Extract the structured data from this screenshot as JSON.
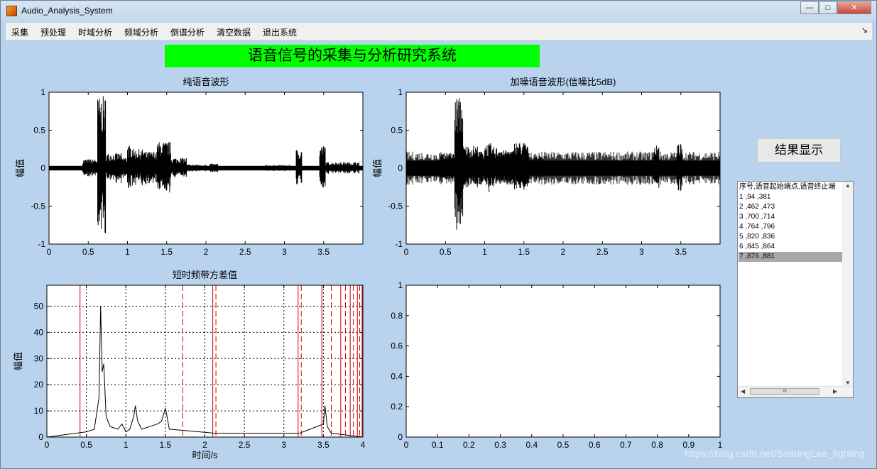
{
  "window": {
    "title": "Audio_Analysis_System",
    "buttons": {
      "minimize": "—",
      "maximize": "□",
      "close": "✕"
    }
  },
  "menu": {
    "items": [
      "采集",
      "预处理",
      "时域分析",
      "频域分析",
      "倒谱分析",
      "清空数据",
      "退出系统"
    ],
    "more": "↘"
  },
  "banner": {
    "title": "语音信号的采集与分析研究系统",
    "color": "#00ff00"
  },
  "result_button": {
    "label": "结果显示"
  },
  "results_list": {
    "header": "序号,语音起始端点,语音终止端",
    "rows": [
      "1 ,94 ,381",
      "2 ,462 ,473",
      "3 ,700 ,714",
      "4 ,764 ,796",
      "5 ,820 ,836",
      "6 ,845 ,864",
      "7 ,876 ,881"
    ],
    "selected_index": 6,
    "h_thumb_glyph": "III"
  },
  "chart_data": [
    {
      "id": "clean",
      "type": "line",
      "title": "纯语音波形",
      "xlabel": "",
      "ylabel": "幅值",
      "xlim": [
        0,
        4
      ],
      "ylim": [
        -1,
        1
      ],
      "xticks": [
        "0",
        "0.5",
        "1",
        "1.5",
        "2",
        "2.5",
        "3",
        "3.5"
      ],
      "yticks": [
        "-1",
        "-0.5",
        "0",
        "0.5",
        "1"
      ],
      "segments": [
        [
          0.43,
          0.62,
          0.12
        ],
        [
          0.62,
          0.72,
          0.95
        ],
        [
          0.72,
          0.92,
          0.2
        ],
        [
          0.92,
          1.0,
          0.15
        ],
        [
          1.0,
          1.08,
          0.3
        ],
        [
          1.08,
          1.22,
          0.25
        ],
        [
          1.22,
          1.38,
          0.22
        ],
        [
          1.38,
          1.55,
          0.35
        ],
        [
          1.55,
          1.75,
          0.14
        ],
        [
          1.75,
          2.0,
          0.05
        ],
        [
          2.05,
          2.15,
          0.06
        ],
        [
          2.75,
          3.1,
          0.04
        ],
        [
          3.15,
          3.22,
          0.25
        ],
        [
          3.45,
          3.52,
          0.3
        ],
        [
          3.52,
          3.95,
          0.08
        ]
      ],
      "color": "#000000"
    },
    {
      "id": "noisy",
      "type": "line",
      "title": "加噪语音波形(信噪比5dB)",
      "xlabel": "",
      "ylabel": "幅值",
      "xlim": [
        0,
        4
      ],
      "ylim": [
        -1,
        1
      ],
      "xticks": [
        "0",
        "0.5",
        "1",
        "1.5",
        "2",
        "2.5",
        "3",
        "3.5"
      ],
      "yticks": [
        "-1",
        "-0.5",
        "0",
        "0.5",
        "1"
      ],
      "noise": 0.1,
      "segments": [
        [
          0.43,
          0.62,
          0.2
        ],
        [
          0.62,
          0.72,
          0.95
        ],
        [
          0.72,
          0.92,
          0.3
        ],
        [
          0.92,
          1.0,
          0.22
        ],
        [
          1.0,
          1.08,
          0.33
        ],
        [
          1.08,
          1.22,
          0.28
        ],
        [
          1.22,
          1.38,
          0.24
        ],
        [
          1.38,
          1.55,
          0.35
        ],
        [
          1.55,
          1.75,
          0.15
        ],
        [
          3.15,
          3.22,
          0.3
        ],
        [
          3.45,
          3.52,
          0.32
        ]
      ],
      "color": "#000000"
    },
    {
      "id": "variance",
      "type": "line",
      "title": "短时频带方差值",
      "xlabel": "时间/s",
      "ylabel": "幅值",
      "xlim": [
        0,
        4
      ],
      "ylim": [
        0,
        58
      ],
      "grid": true,
      "xticks": [
        "0",
        "0.5",
        "1",
        "1.5",
        "2",
        "2.5",
        "3",
        "3.5",
        "4"
      ],
      "yticks": [
        "0",
        "10",
        "20",
        "30",
        "40",
        "50"
      ],
      "peaks": [
        [
          0.5,
          2
        ],
        [
          0.6,
          3
        ],
        [
          0.66,
          15
        ],
        [
          0.68,
          50
        ],
        [
          0.7,
          25
        ],
        [
          0.72,
          28
        ],
        [
          0.75,
          8
        ],
        [
          0.8,
          4
        ],
        [
          0.9,
          3
        ],
        [
          0.95,
          5
        ],
        [
          1.0,
          2
        ],
        [
          1.05,
          3
        ],
        [
          1.1,
          8
        ],
        [
          1.12,
          12
        ],
        [
          1.15,
          6
        ],
        [
          1.2,
          3
        ],
        [
          1.3,
          4
        ],
        [
          1.4,
          5
        ],
        [
          1.45,
          6
        ],
        [
          1.5,
          11
        ],
        [
          1.52,
          8
        ],
        [
          1.55,
          3
        ],
        [
          2.12,
          1.5
        ],
        [
          3.2,
          1.5
        ],
        [
          3.5,
          5
        ],
        [
          3.52,
          12
        ],
        [
          3.55,
          4
        ],
        [
          3.6,
          1.5
        ]
      ],
      "markers_solid": [
        0.42,
        2.1,
        3.18,
        3.48,
        3.72,
        3.84,
        3.93,
        3.99
      ],
      "markers_dashed": [
        1.72,
        2.14,
        3.22,
        3.6,
        3.78,
        3.88,
        3.96
      ],
      "marker_color": "#d40000",
      "line_color": "#000000"
    },
    {
      "id": "empty",
      "type": "line",
      "title": "",
      "xlim": [
        0,
        1
      ],
      "ylim": [
        0,
        1
      ],
      "xticks": [
        "0",
        "0.1",
        "0.2",
        "0.3",
        "0.4",
        "0.5",
        "0.6",
        "0.7",
        "0.8",
        "0.9",
        "1"
      ],
      "yticks": [
        "0",
        "0.2",
        "0.4",
        "0.6",
        "0.8",
        "1"
      ]
    }
  ],
  "watermark": "https://blog.csdn.net/SoaringLee_fighting"
}
